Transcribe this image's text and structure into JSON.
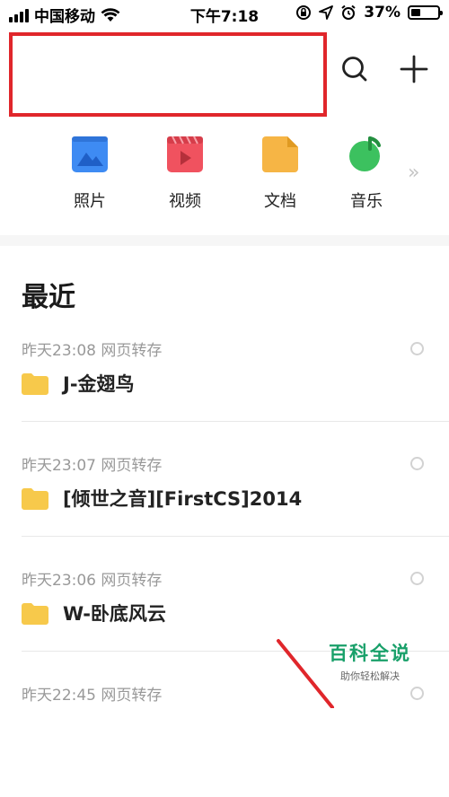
{
  "status_bar": {
    "carrier": "中国移动",
    "time": "下午7:18",
    "battery_percent": "37%",
    "battery_level": 0.37,
    "icons": [
      "signal-icon",
      "wifi-icon",
      "rotation-lock-icon",
      "location-icon",
      "alarm-icon",
      "battery-icon"
    ]
  },
  "header": {
    "search_value": "",
    "icons": [
      "search-icon",
      "add-icon"
    ]
  },
  "quick_access": [
    {
      "label": "照片",
      "icon": "photo-icon",
      "color": "#3e8bf3"
    },
    {
      "label": "视频",
      "icon": "video-icon",
      "color": "#f0525f"
    },
    {
      "label": "文档",
      "icon": "document-icon",
      "color": "#f6b545"
    },
    {
      "label": "音乐",
      "icon": "music-icon",
      "color": "#3cc15f"
    },
    {
      "label": "",
      "icon": "more-chevron-icon",
      "color": "#c5c5c5"
    }
  ],
  "recent": {
    "title": "最近",
    "entries": [
      {
        "meta": "昨天23:08 网页转存",
        "name": "J-金翅鸟"
      },
      {
        "meta": "昨天23:07 网页转存",
        "name": "[倾世之音][FirstCS]2014"
      },
      {
        "meta": "昨天23:06 网页转存",
        "name": "W-卧底风云"
      },
      {
        "meta": "昨天22:45 网页转存",
        "name": ""
      }
    ]
  },
  "watermark": {
    "title": "百科全说",
    "subtitle": "助你轻松解决"
  },
  "colors": {
    "highlight_border": "#e0262b",
    "folder": "#f7c94b",
    "watermark_green": "#19a06a"
  }
}
